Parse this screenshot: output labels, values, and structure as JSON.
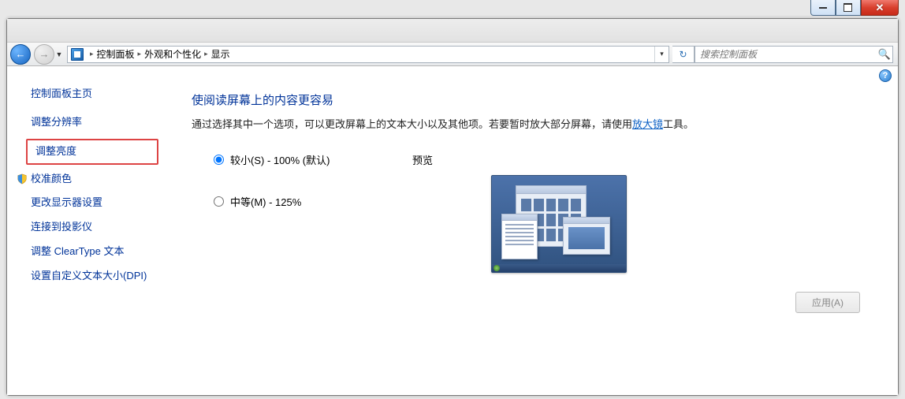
{
  "titlebar": {
    "minimize_tip": "最小化",
    "maximize_tip": "最大化",
    "close_tip": "关闭"
  },
  "nav": {
    "back_tip": "返回",
    "forward_tip": "前进"
  },
  "breadcrumb": {
    "root": "控制面板",
    "cat": "外观和个性化",
    "page": "显示"
  },
  "search": {
    "placeholder": "搜索控制面板"
  },
  "sidebar": {
    "home": "控制面板主页",
    "items": [
      "调整分辨率",
      "调整亮度",
      "校准颜色",
      "更改显示器设置",
      "连接到投影仪",
      "调整 ClearType 文本",
      "设置自定义文本大小(DPI)"
    ]
  },
  "main": {
    "title": "使阅读屏幕上的内容更容易",
    "desc_pre": "通过选择其中一个选项，可以更改屏幕上的文本大小以及其他项。若要暂时放大部分屏幕，请使用",
    "desc_link": "放大镜",
    "desc_post": "工具。",
    "opt_small": "较小(S) - 100% (默认)",
    "opt_medium": "中等(M) - 125%",
    "preview_label": "预览",
    "apply": "应用(A)",
    "help_tip": "帮助"
  }
}
